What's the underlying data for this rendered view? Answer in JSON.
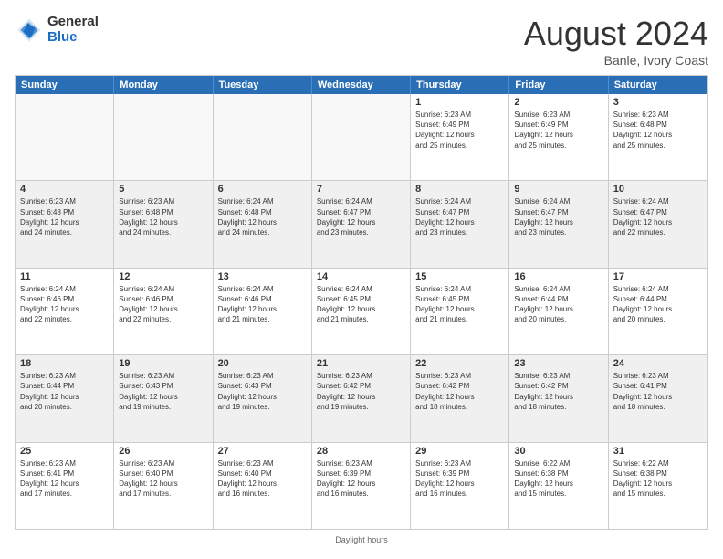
{
  "logo": {
    "text_general": "General",
    "text_blue": "Blue"
  },
  "header": {
    "month": "August 2024",
    "location": "Banle, Ivory Coast"
  },
  "days": [
    "Sunday",
    "Monday",
    "Tuesday",
    "Wednesday",
    "Thursday",
    "Friday",
    "Saturday"
  ],
  "footer": "Daylight hours",
  "weeks": [
    [
      {
        "day": "",
        "text": ""
      },
      {
        "day": "",
        "text": ""
      },
      {
        "day": "",
        "text": ""
      },
      {
        "day": "",
        "text": ""
      },
      {
        "day": "1",
        "text": "Sunrise: 6:23 AM\nSunset: 6:49 PM\nDaylight: 12 hours\nand 25 minutes."
      },
      {
        "day": "2",
        "text": "Sunrise: 6:23 AM\nSunset: 6:49 PM\nDaylight: 12 hours\nand 25 minutes."
      },
      {
        "day": "3",
        "text": "Sunrise: 6:23 AM\nSunset: 6:48 PM\nDaylight: 12 hours\nand 25 minutes."
      }
    ],
    [
      {
        "day": "4",
        "text": "Sunrise: 6:23 AM\nSunset: 6:48 PM\nDaylight: 12 hours\nand 24 minutes."
      },
      {
        "day": "5",
        "text": "Sunrise: 6:23 AM\nSunset: 6:48 PM\nDaylight: 12 hours\nand 24 minutes."
      },
      {
        "day": "6",
        "text": "Sunrise: 6:24 AM\nSunset: 6:48 PM\nDaylight: 12 hours\nand 24 minutes."
      },
      {
        "day": "7",
        "text": "Sunrise: 6:24 AM\nSunset: 6:47 PM\nDaylight: 12 hours\nand 23 minutes."
      },
      {
        "day": "8",
        "text": "Sunrise: 6:24 AM\nSunset: 6:47 PM\nDaylight: 12 hours\nand 23 minutes."
      },
      {
        "day": "9",
        "text": "Sunrise: 6:24 AM\nSunset: 6:47 PM\nDaylight: 12 hours\nand 23 minutes."
      },
      {
        "day": "10",
        "text": "Sunrise: 6:24 AM\nSunset: 6:47 PM\nDaylight: 12 hours\nand 22 minutes."
      }
    ],
    [
      {
        "day": "11",
        "text": "Sunrise: 6:24 AM\nSunset: 6:46 PM\nDaylight: 12 hours\nand 22 minutes."
      },
      {
        "day": "12",
        "text": "Sunrise: 6:24 AM\nSunset: 6:46 PM\nDaylight: 12 hours\nand 22 minutes."
      },
      {
        "day": "13",
        "text": "Sunrise: 6:24 AM\nSunset: 6:46 PM\nDaylight: 12 hours\nand 21 minutes."
      },
      {
        "day": "14",
        "text": "Sunrise: 6:24 AM\nSunset: 6:45 PM\nDaylight: 12 hours\nand 21 minutes."
      },
      {
        "day": "15",
        "text": "Sunrise: 6:24 AM\nSunset: 6:45 PM\nDaylight: 12 hours\nand 21 minutes."
      },
      {
        "day": "16",
        "text": "Sunrise: 6:24 AM\nSunset: 6:44 PM\nDaylight: 12 hours\nand 20 minutes."
      },
      {
        "day": "17",
        "text": "Sunrise: 6:24 AM\nSunset: 6:44 PM\nDaylight: 12 hours\nand 20 minutes."
      }
    ],
    [
      {
        "day": "18",
        "text": "Sunrise: 6:23 AM\nSunset: 6:44 PM\nDaylight: 12 hours\nand 20 minutes."
      },
      {
        "day": "19",
        "text": "Sunrise: 6:23 AM\nSunset: 6:43 PM\nDaylight: 12 hours\nand 19 minutes."
      },
      {
        "day": "20",
        "text": "Sunrise: 6:23 AM\nSunset: 6:43 PM\nDaylight: 12 hours\nand 19 minutes."
      },
      {
        "day": "21",
        "text": "Sunrise: 6:23 AM\nSunset: 6:42 PM\nDaylight: 12 hours\nand 19 minutes."
      },
      {
        "day": "22",
        "text": "Sunrise: 6:23 AM\nSunset: 6:42 PM\nDaylight: 12 hours\nand 18 minutes."
      },
      {
        "day": "23",
        "text": "Sunrise: 6:23 AM\nSunset: 6:42 PM\nDaylight: 12 hours\nand 18 minutes."
      },
      {
        "day": "24",
        "text": "Sunrise: 6:23 AM\nSunset: 6:41 PM\nDaylight: 12 hours\nand 18 minutes."
      }
    ],
    [
      {
        "day": "25",
        "text": "Sunrise: 6:23 AM\nSunset: 6:41 PM\nDaylight: 12 hours\nand 17 minutes."
      },
      {
        "day": "26",
        "text": "Sunrise: 6:23 AM\nSunset: 6:40 PM\nDaylight: 12 hours\nand 17 minutes."
      },
      {
        "day": "27",
        "text": "Sunrise: 6:23 AM\nSunset: 6:40 PM\nDaylight: 12 hours\nand 16 minutes."
      },
      {
        "day": "28",
        "text": "Sunrise: 6:23 AM\nSunset: 6:39 PM\nDaylight: 12 hours\nand 16 minutes."
      },
      {
        "day": "29",
        "text": "Sunrise: 6:23 AM\nSunset: 6:39 PM\nDaylight: 12 hours\nand 16 minutes."
      },
      {
        "day": "30",
        "text": "Sunrise: 6:22 AM\nSunset: 6:38 PM\nDaylight: 12 hours\nand 15 minutes."
      },
      {
        "day": "31",
        "text": "Sunrise: 6:22 AM\nSunset: 6:38 PM\nDaylight: 12 hours\nand 15 minutes."
      }
    ]
  ]
}
